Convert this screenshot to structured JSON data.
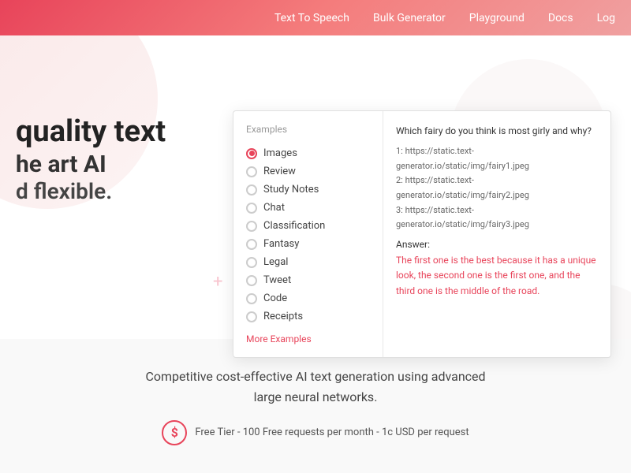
{
  "header": {
    "nav_items": [
      {
        "label": "Text To Speech",
        "id": "text-to-speech"
      },
      {
        "label": "Bulk Generator",
        "id": "bulk-generator"
      },
      {
        "label": "Playground",
        "id": "playground"
      },
      {
        "label": "Docs",
        "id": "docs"
      },
      {
        "label": "Log",
        "id": "log"
      }
    ]
  },
  "hero": {
    "line1": "quality text",
    "line2": "he art AI",
    "line3": "d flexible."
  },
  "examples": {
    "title": "Examples",
    "items": [
      {
        "label": "Images",
        "selected": true
      },
      {
        "label": "Review",
        "selected": false
      },
      {
        "label": "Study Notes",
        "selected": false
      },
      {
        "label": "Chat",
        "selected": false
      },
      {
        "label": "Classification",
        "selected": false
      },
      {
        "label": "Fantasy",
        "selected": false
      },
      {
        "label": "Legal",
        "selected": false
      },
      {
        "label": "Tweet",
        "selected": false
      },
      {
        "label": "Code",
        "selected": false
      },
      {
        "label": "Receipts",
        "selected": false
      }
    ],
    "more_label": "More Examples",
    "question": "Which fairy do you think is most girly and why?",
    "urls": [
      "1: https://static.text-generator.io/static/img/fairy1.jpeg",
      "2: https://static.text-generator.io/static/img/fairy2.jpeg",
      "3: https://static.text-generator.io/static/img/fairy3.jpeg"
    ],
    "answer_label": "Answer:",
    "answer_text": "The first one is the best because it has a unique look, the second one is the first one, and the third one is the middle of the road."
  },
  "bottom": {
    "description": "Competitive cost-effective AI text generation using advanced large neural networks.",
    "free_tier": "Free Tier - 100 Free requests per month - 1c USD per request"
  }
}
